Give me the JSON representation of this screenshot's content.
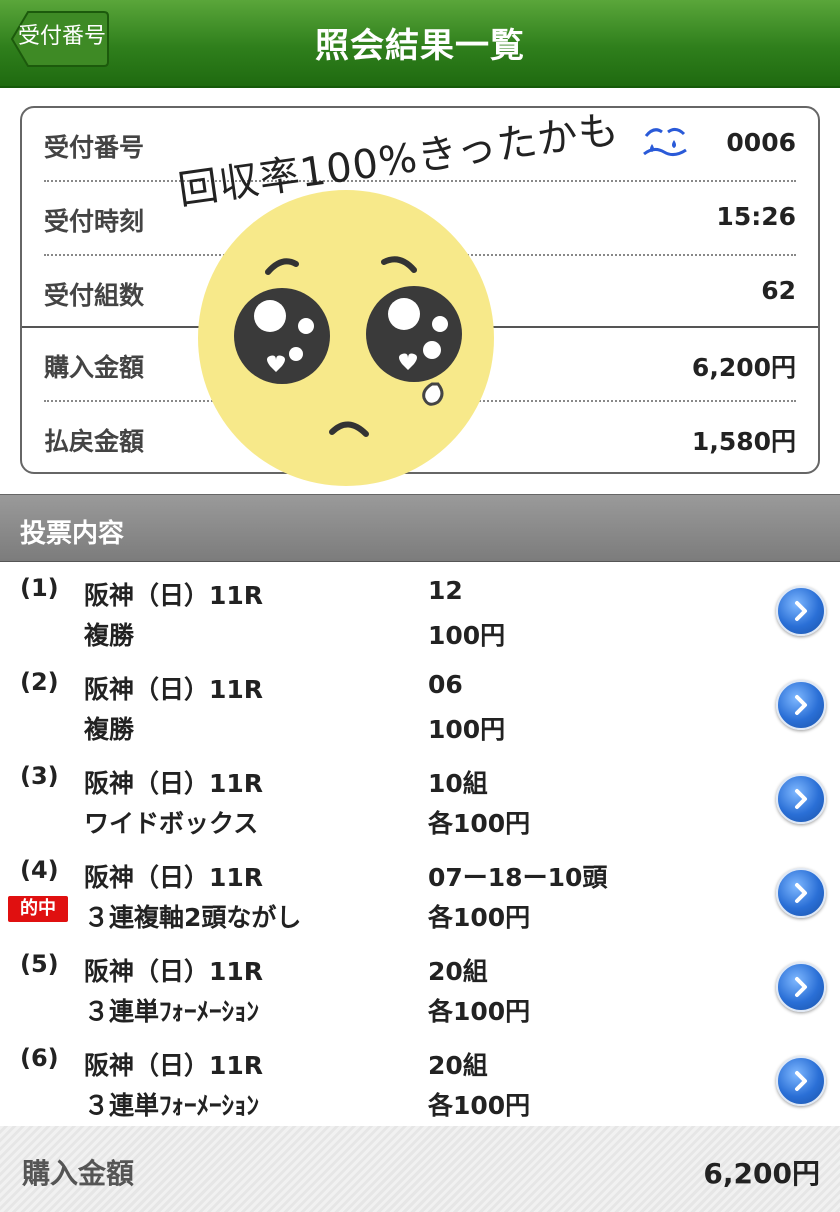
{
  "header": {
    "title": "照会結果一覧",
    "back_label": "受付番号"
  },
  "summary": [
    {
      "label": "受付番号",
      "value": "0006"
    },
    {
      "label": "受付時刻",
      "value": "15:26"
    },
    {
      "label": "受付組数",
      "value": "62"
    },
    {
      "label": "購入金額",
      "value": "6,200円"
    },
    {
      "label": "払戻金額",
      "value": "1,580円"
    }
  ],
  "section_title": "投票内容",
  "bets": [
    {
      "num": "(1)",
      "venue": "阪神（日）11R",
      "type": "複勝",
      "selection": "12",
      "amount": "100円",
      "hit": false
    },
    {
      "num": "(2)",
      "venue": "阪神（日）11R",
      "type": "複勝",
      "selection": "06",
      "amount": "100円",
      "hit": false
    },
    {
      "num": "(3)",
      "venue": "阪神（日）11R",
      "type": "ワイドボックス",
      "selection": "10組",
      "amount": "各100円",
      "hit": false
    },
    {
      "num": "(4)",
      "venue": "阪神（日）11R",
      "type": "３連複軸2頭ながし",
      "selection": "07ー18ー10頭",
      "amount": "各100円",
      "hit": true,
      "hit_label": "的中"
    },
    {
      "num": "(5)",
      "venue": "阪神（日）11R",
      "type": "３連単ﾌｫｰﾒｰｼｮﾝ",
      "selection": "20組",
      "amount": "各100円",
      "hit": false
    },
    {
      "num": "(6)",
      "venue": "阪神（日）11R",
      "type": "３連単ﾌｫｰﾒｰｼｮﾝ",
      "selection": "20組",
      "amount": "各100円",
      "hit": false
    }
  ],
  "footer": {
    "label": "購入金額",
    "value": "6,200円"
  },
  "overlay": {
    "handwriting": "回収率100%きったかも",
    "emoji": "pleading-face",
    "sticker_icon": "sweat-drops-icon"
  },
  "colors": {
    "header_green": "#2f7f1c",
    "hit_red": "#e01010",
    "arrow_blue": "#2a6fd6",
    "emoji_yellow": "#f7e98a"
  }
}
